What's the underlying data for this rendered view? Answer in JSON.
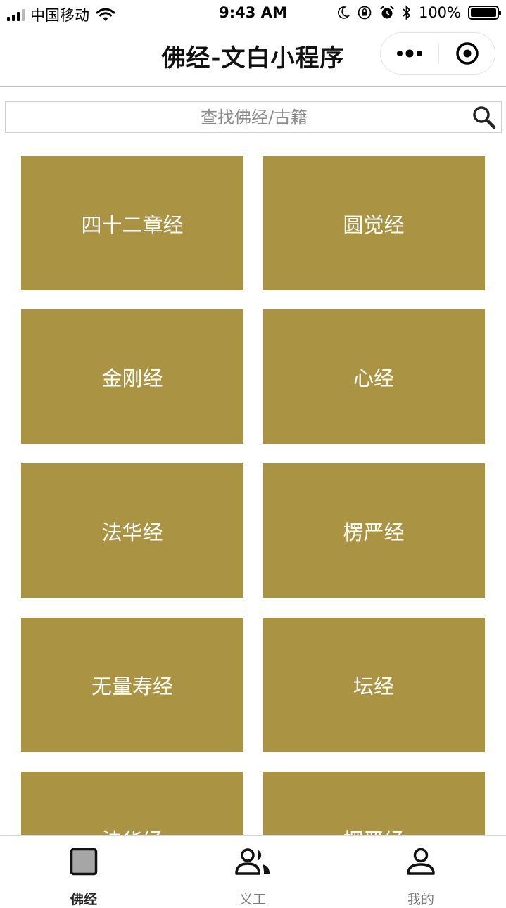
{
  "status_bar": {
    "carrier": "中国移动",
    "time": "9:43 AM",
    "battery": "100%"
  },
  "nav": {
    "title": "佛经-文白小程序"
  },
  "search": {
    "placeholder": "查找佛经/古籍"
  },
  "cards": [
    {
      "label": "四十二章经"
    },
    {
      "label": "圆觉经"
    },
    {
      "label": "金刚经"
    },
    {
      "label": "心经"
    },
    {
      "label": "法华经"
    },
    {
      "label": "楞严经"
    },
    {
      "label": "无量寿经"
    },
    {
      "label": "坛经"
    },
    {
      "label": "法华经"
    },
    {
      "label": "楞严经"
    }
  ],
  "tabs": [
    {
      "label": "佛经",
      "icon": "book-icon"
    },
    {
      "label": "义工",
      "icon": "people-icon"
    },
    {
      "label": "我的",
      "icon": "person-icon"
    }
  ],
  "colors": {
    "card": "#aa9444",
    "card_text": "#ffffff"
  }
}
